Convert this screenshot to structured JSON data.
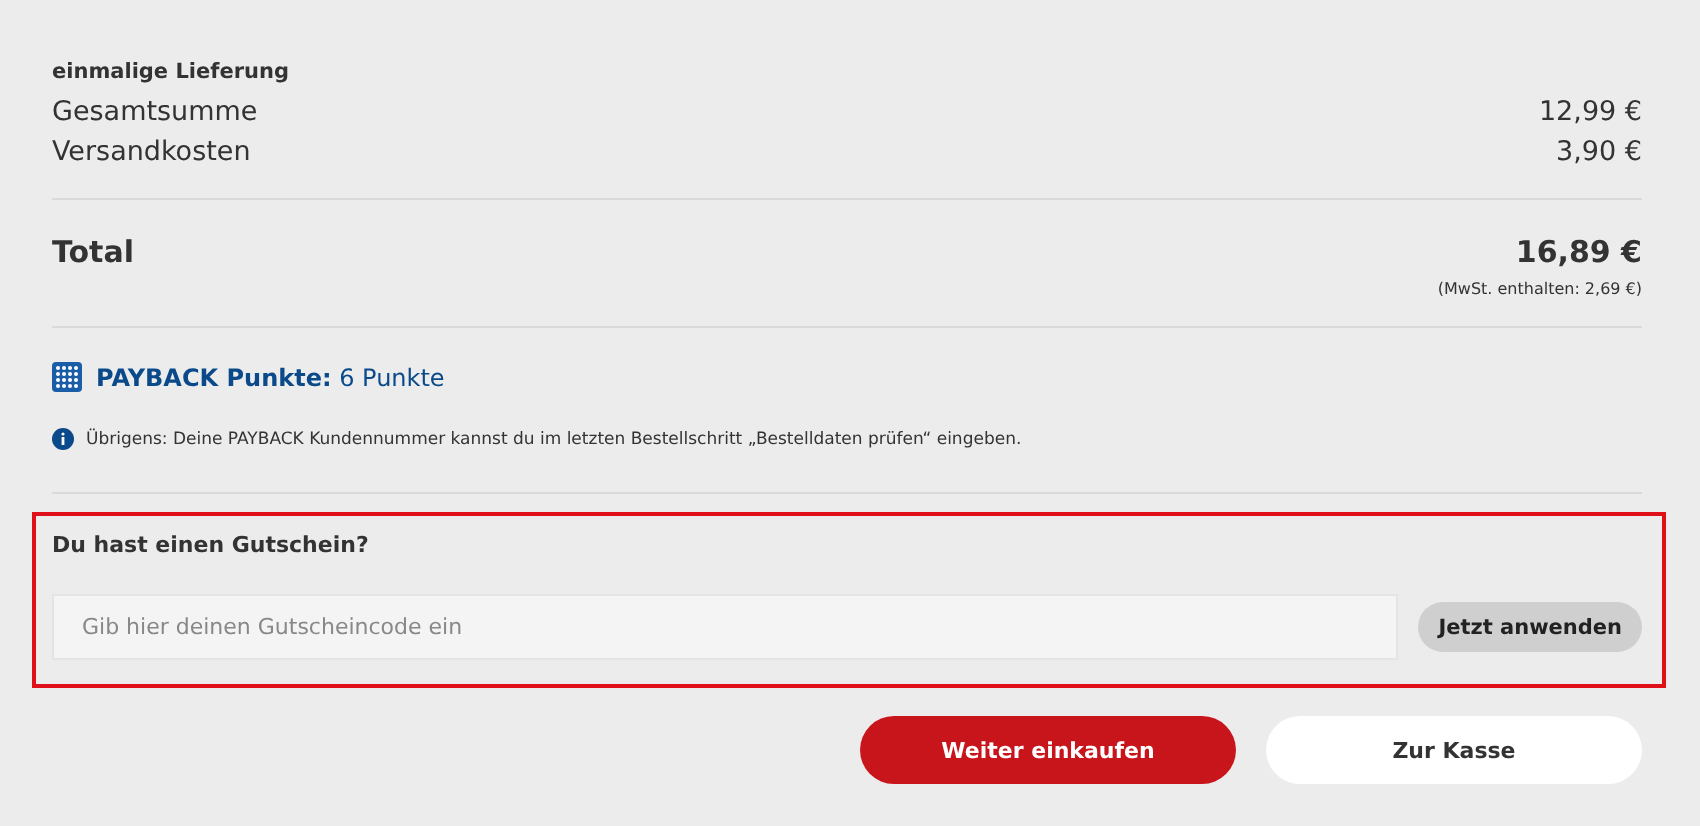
{
  "delivery_heading": "einmalige Lieferung",
  "lines": [
    {
      "label": "Gesamtsumme",
      "amount": "12,99 €"
    },
    {
      "label": "Versandkosten",
      "amount": "3,90 €"
    }
  ],
  "total": {
    "label": "Total",
    "amount": "16,89 €",
    "vat_note": "(MwSt. enthalten: 2,69 €)"
  },
  "payback": {
    "text": "**PAYBACK Punkte:** 6 Punkte"
  },
  "info": "Übrigens: Deine PAYBACK Kundennummer kannst du im letzten Bestellschritt „Bestelldaten prüfen“ eingeben.",
  "voucher": {
    "heading": "Du hast einen Gutschein?",
    "placeholder": "Gib hier deinen Gutscheincode ein",
    "button": "Jetzt anwenden"
  },
  "buttons": [
    {
      "label": "Weiter einkaufen",
      "kind": "primary"
    },
    {
      "label": "Zur Kasse",
      "kind": "secondary"
    }
  ]
}
